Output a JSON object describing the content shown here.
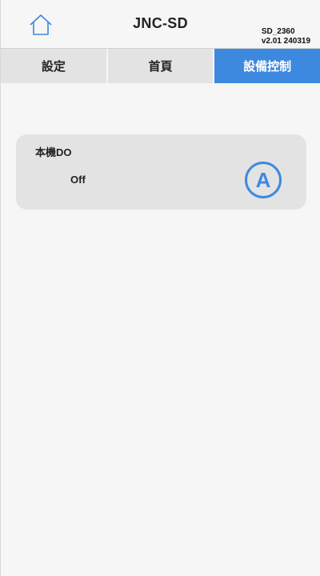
{
  "header": {
    "title": "JNC-SD",
    "device_id": "SD_2360",
    "version": "v2.01 240319",
    "home_icon": "home-icon"
  },
  "tabs": [
    {
      "label": "設定",
      "active": false
    },
    {
      "label": "首頁",
      "active": false
    },
    {
      "label": "設備控制",
      "active": true
    }
  ],
  "colors": {
    "accent": "#3d89e0",
    "tab_bg": "#e3e3e3",
    "card_bg": "#e3e3e3",
    "page_bg": "#f6f6f6"
  },
  "controls": [
    {
      "title": "本機DO",
      "state": "Off",
      "mode_badge": "A"
    }
  ]
}
